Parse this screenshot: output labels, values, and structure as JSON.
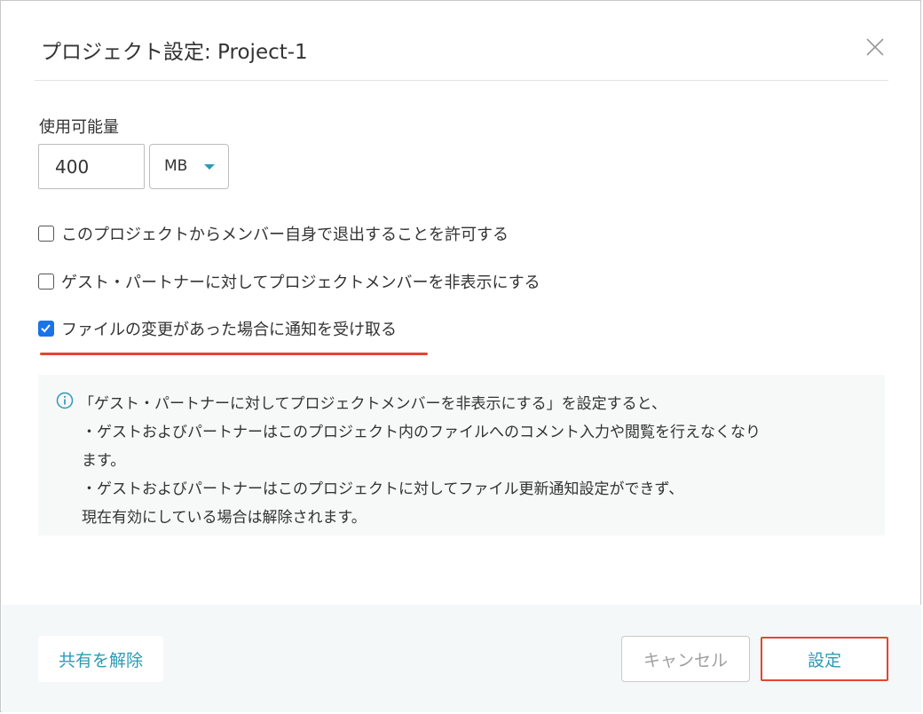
{
  "dialog": {
    "title": "プロジェクト設定: Project-1"
  },
  "quota": {
    "label": "使用可能量",
    "value": "400",
    "unit": "MB"
  },
  "options": [
    {
      "label": "このプロジェクトからメンバー自身で退出することを許可する",
      "checked": false
    },
    {
      "label": "ゲスト・パートナーに対してプロジェクトメンバーを非表示にする",
      "checked": false
    },
    {
      "label": "ファイルの変更があった場合に通知を受け取る",
      "checked": true
    }
  ],
  "info": {
    "icon": "info-circle-icon",
    "lines": [
      "「ゲスト・パートナーに対してプロジェクトメンバーを非表示にする」を設定すると、",
      "・ゲストおよびパートナーはこのプロジェクト内のファイルへのコメント入力や閲覧を行えなくなり",
      "ます。",
      "・ゲストおよびパートナーはこのプロジェクトに対してファイル更新通知設定ができず、",
      "現在有効にしている場合は解除されます。"
    ]
  },
  "footer": {
    "unshare_label": "共有を解除",
    "cancel_label": "キャンセル",
    "submit_label": "設定"
  },
  "colors": {
    "accent": "#2a9bb5",
    "highlight": "#e5452f",
    "checkbox_checked": "#1a73e8",
    "info_bg": "#f7f8f8",
    "footer_bg": "#f4f8f9"
  }
}
